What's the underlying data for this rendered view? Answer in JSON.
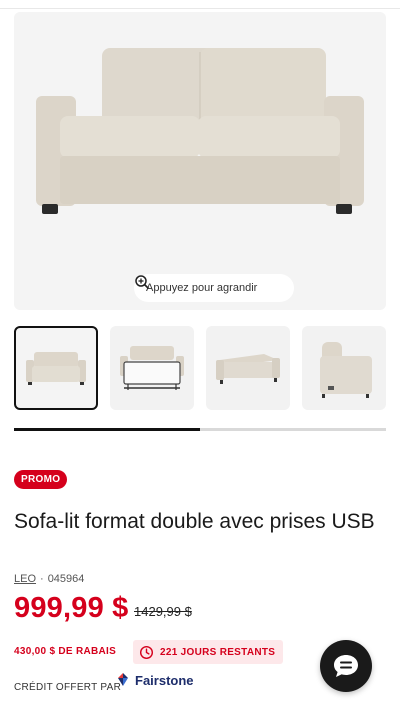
{
  "gallery": {
    "zoom_label": "Appuyez pour agrandir",
    "thumbnail_count": 4,
    "active_thumbnail": 1,
    "scroll_progress": 0.5
  },
  "product": {
    "badge": "PROMO",
    "title": "Sofa-lit format double avec prises USB",
    "brand": "LEO",
    "separator": "·",
    "sku": "045964",
    "price": "999,99 $",
    "old_price": "1429,99 $",
    "rebate": "430,00 $ DE RABAIS",
    "days_left": "221 JOURS RESTANTS",
    "credit_label": "CRÉDIT OFFERT PAR",
    "financing_brand": "Fairstone"
  },
  "colors": {
    "accent_red": "#d5001c",
    "badge_bg": "#d5001c",
    "days_bg": "#fde8ea",
    "fairstone_blue": "#1d2d6b"
  },
  "icons": {
    "zoom": "zoom-in-icon",
    "clock": "clock-icon",
    "chat": "chat-icon",
    "financing": "fairstone-logo-icon"
  }
}
